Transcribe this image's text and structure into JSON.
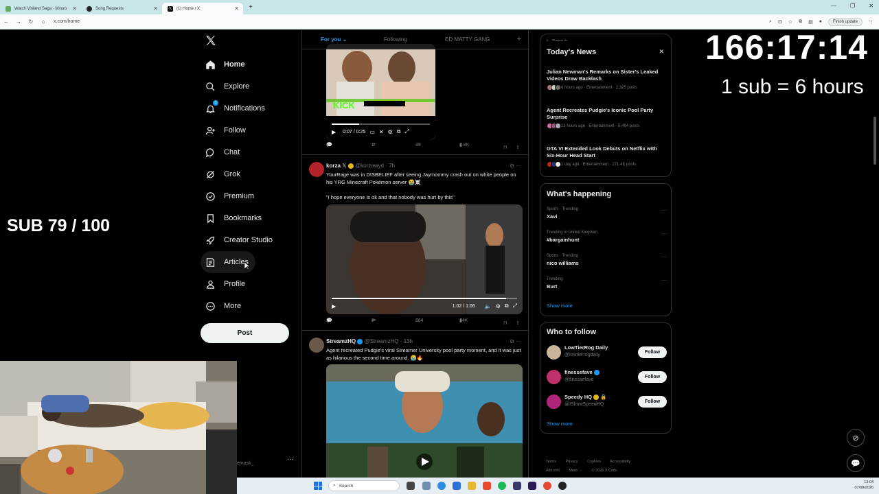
{
  "browser": {
    "tabs": [
      {
        "label": "Watch Vinland Saga - Miruro",
        "active": false
      },
      {
        "label": "Song Requests",
        "active": false
      },
      {
        "label": "(1) Home / X",
        "active": true
      }
    ],
    "url": "x.com/home",
    "finish_update": "Finish update"
  },
  "overlay": {
    "timer": "166:17:14",
    "sub_rate": "1 sub = 6 hours",
    "sub_goal": "SUB 79 / 100"
  },
  "nav": {
    "items": [
      {
        "label": "Home",
        "icon": "home-icon"
      },
      {
        "label": "Explore",
        "icon": "search-icon"
      },
      {
        "label": "Notifications",
        "icon": "bell-icon",
        "badge": "1"
      },
      {
        "label": "Follow",
        "icon": "person-add-icon"
      },
      {
        "label": "Chat",
        "icon": "chat-icon"
      },
      {
        "label": "Grok",
        "icon": "grok-icon"
      },
      {
        "label": "Premium",
        "icon": "premium-icon"
      },
      {
        "label": "Bookmarks",
        "icon": "bookmark-icon"
      },
      {
        "label": "Creator Studio",
        "icon": "rocket-icon"
      },
      {
        "label": "Articles",
        "icon": "article-icon"
      },
      {
        "label": "Profile",
        "icon": "person-icon"
      },
      {
        "label": "More",
        "icon": "more-icon"
      }
    ],
    "post_button": "Post",
    "account_handle": "emask_"
  },
  "feed": {
    "tabs": [
      "For you",
      "Following",
      "ED MATTY GANG"
    ],
    "post0": {
      "kick_label": "KICK",
      "time": "0:07 / 0:25",
      "replies": "3",
      "reposts": "1",
      "likes": "29",
      "views": "4.8K"
    },
    "post1": {
      "name": "korza",
      "handle": "@korzawyd",
      "time": "7h",
      "text": "YourRage was in DISBELIEF after seeing Jaymommy crash out on white people on his YRG Minecraft Pokémon server 😭☠️",
      "quote": "\"I hope everyone is ok and that nobody was hurt by this\"",
      "video_time": "1:02 / 1:06",
      "replies": "21",
      "reposts": "8",
      "likes": "664",
      "views": "34K"
    },
    "post2": {
      "name": "StreamzHQ",
      "handle": "@StreamzHQ",
      "time": "13h",
      "text": "Agent recreated Pudgie's viral Streamer University pool party moment, and it was just as hilarious the second time around. 😭🔥"
    }
  },
  "sidebar": {
    "search_placeholder": "Search",
    "news_title": "Today's News",
    "news": [
      {
        "title": "Julian Newman's Remarks on Sister's Leaked Videos Draw Backlash",
        "meta": "6 hours ago · Entertainment · 2,325 posts"
      },
      {
        "title": "Agent Recreates Pudgie's Iconic Pool Party Surprise",
        "meta": "13 hours ago · Entertainment · 5,464 posts"
      },
      {
        "title": "GTA VI Extended Look Debuts on Netflix with Six-Hour Head Start",
        "meta": "1 day ago · Entertainment · 271.4K posts"
      }
    ],
    "happening_title": "What's happening",
    "trends": [
      {
        "context": "Sports · Trending",
        "name": "Xavi"
      },
      {
        "context": "Trending in United Kingdom",
        "name": "#bargainhunt"
      },
      {
        "context": "Sports · Trending",
        "name": "nico williams"
      },
      {
        "context": "Trending",
        "name": "Burt"
      }
    ],
    "show_more": "Show more",
    "who_title": "Who to follow",
    "who": [
      {
        "name": "LowTierRog Daily",
        "handle": "@lowtierrogdaily",
        "button": "Follow"
      },
      {
        "name": "finessefave",
        "handle": "@finessefave",
        "button": "Follow"
      },
      {
        "name": "Speedy HQ",
        "handle": "@IShowSpeedHQ",
        "button": "Follow"
      }
    ],
    "show_more_2": "Show more",
    "footer": [
      "Terms",
      "Privacy",
      "Cookies",
      "Accessibility",
      "Ads info",
      "More ···",
      "© 2026 X Corp."
    ]
  },
  "taskbar": {
    "search": "Search",
    "time": "13:04",
    "date": "07/08/2026"
  },
  "colors": {
    "accent": "#1d9bf0",
    "background": "#000000",
    "border": "#2f3336",
    "muted_text": "#71767b"
  }
}
